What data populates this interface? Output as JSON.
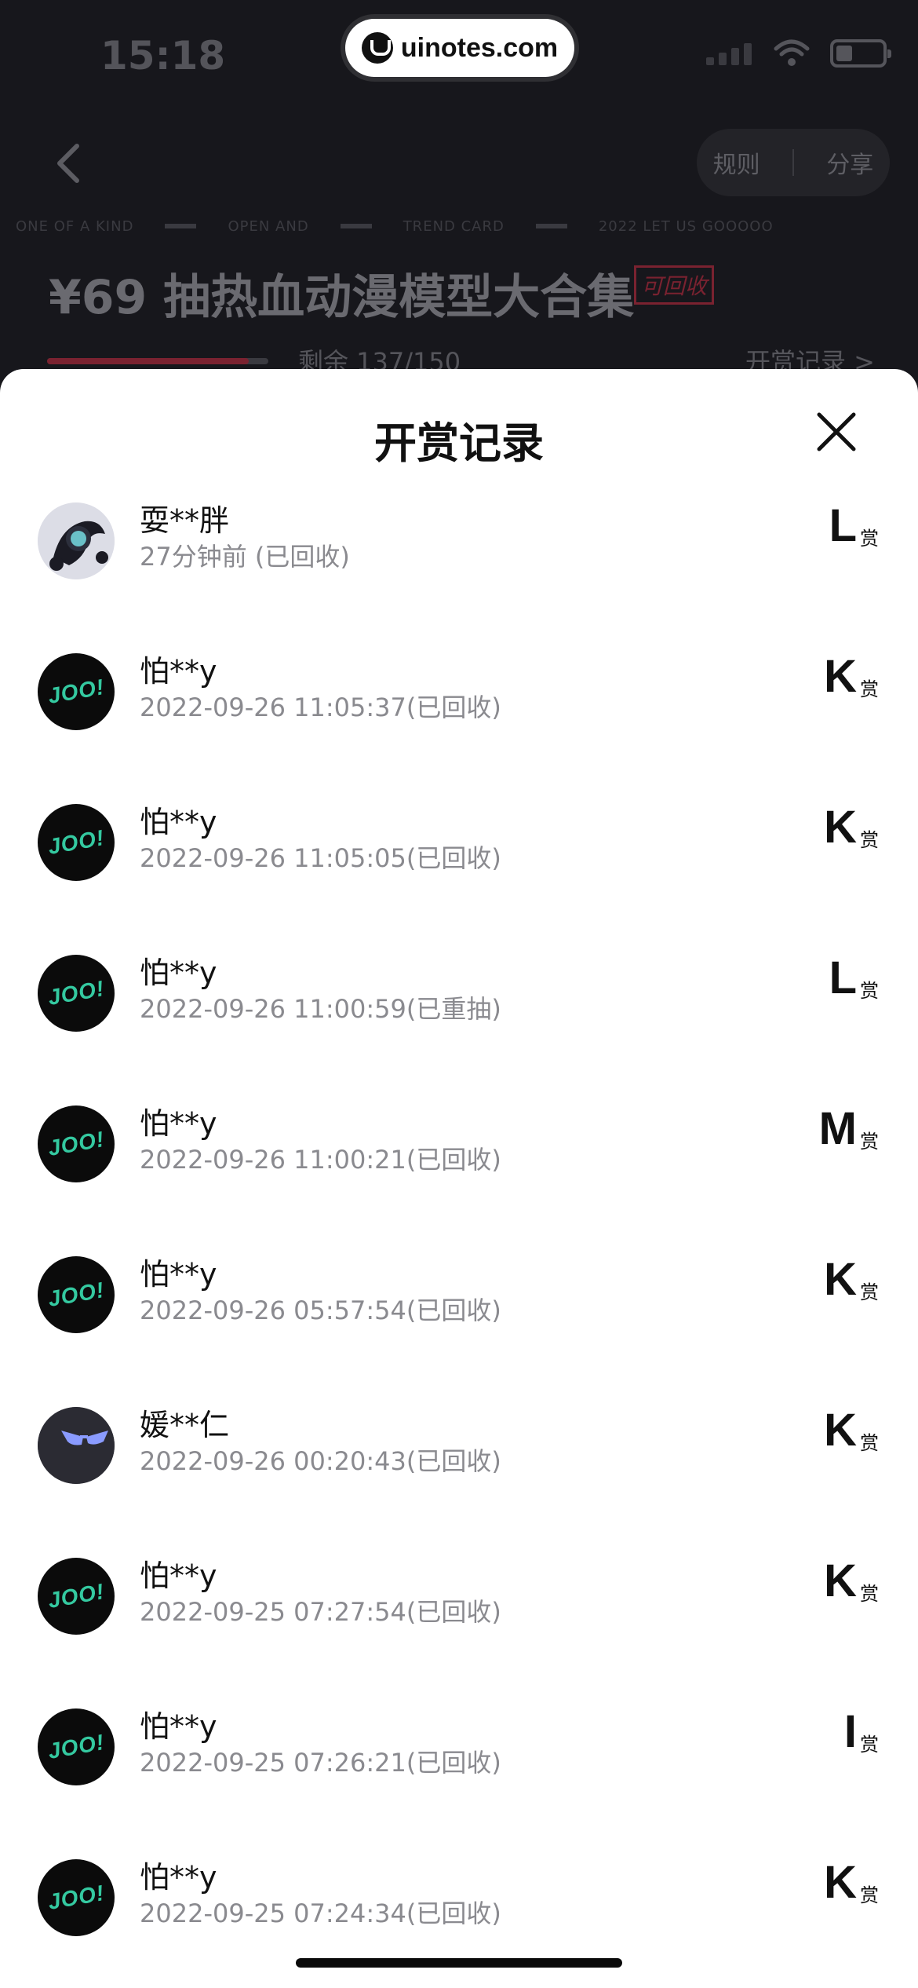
{
  "status": {
    "time": "15:18"
  },
  "watermark": {
    "text": "uinotes.com"
  },
  "header": {
    "rules_label": "规则",
    "share_label": "分享"
  },
  "ticker": {
    "items": [
      "ONE OF A KIND",
      "OPEN AND",
      "TREND CARD",
      "2022 LET US GOOOOO"
    ]
  },
  "product": {
    "title": "¥69 抽热血动漫模型大合集",
    "tag": "可回收",
    "remaining": "剩余 137/150",
    "remaining_fraction": 0.913,
    "records_link": "开赏记录 >"
  },
  "sheet": {
    "title": "开赏记录",
    "grade_suffix": "赏",
    "records": [
      {
        "name": "耍**胖",
        "time": "27分钟前 (已回收)",
        "grade": "L",
        "avatar": "robot"
      },
      {
        "name": "怕**y",
        "time": "2022-09-26 11:05:37(已回收)",
        "grade": "K",
        "avatar": "joo"
      },
      {
        "name": "怕**y",
        "time": "2022-09-26 11:05:05(已回收)",
        "grade": "K",
        "avatar": "joo"
      },
      {
        "name": "怕**y",
        "time": "2022-09-26 11:00:59(已重抽)",
        "grade": "L",
        "avatar": "joo"
      },
      {
        "name": "怕**y",
        "time": "2022-09-26 11:00:21(已回收)",
        "grade": "M",
        "avatar": "joo"
      },
      {
        "name": "怕**y",
        "time": "2022-09-26 05:57:54(已回收)",
        "grade": "K",
        "avatar": "joo"
      },
      {
        "name": "媛**仁",
        "time": "2022-09-26 00:20:43(已回收)",
        "grade": "K",
        "avatar": "dark"
      },
      {
        "name": "怕**y",
        "time": "2022-09-25 07:27:54(已回收)",
        "grade": "K",
        "avatar": "joo"
      },
      {
        "name": "怕**y",
        "time": "2022-09-25 07:26:21(已回收)",
        "grade": "I",
        "avatar": "joo"
      },
      {
        "name": "怕**y",
        "time": "2022-09-25 07:24:34(已回收)",
        "grade": "K",
        "avatar": "joo"
      }
    ],
    "joo_text": "JOO!"
  }
}
